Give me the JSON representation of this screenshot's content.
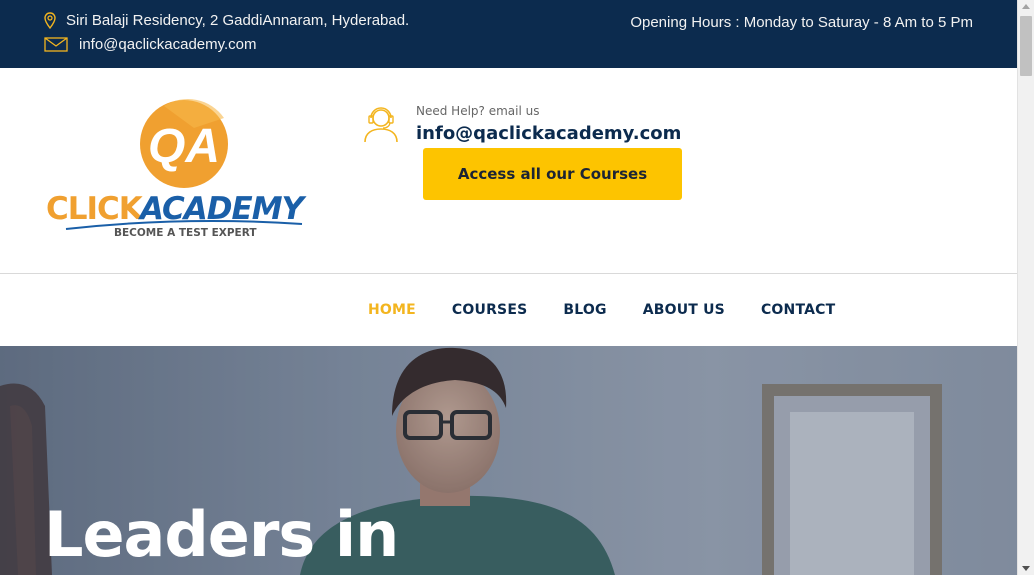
{
  "topbar": {
    "address": "Siri Balaji Residency, 2 GaddiAnnaram, Hyderabad.",
    "email": "info@qaclickacademy.com",
    "hours": "Opening Hours : Monday to Saturay - 8 Am to 5 Pm",
    "icons": [
      "location-pin-icon",
      "envelope-icon"
    ]
  },
  "header": {
    "logo": {
      "monogram": "QA",
      "brand_left": "CLICK",
      "brand_right": "ACADEMY",
      "tagline": "BECOME A TEST EXPERT"
    },
    "help_small": "Need Help? email us",
    "help_email": "info@qaclickacademy.com",
    "help_icon": "support-agent-icon",
    "cta_label": "Access all our Courses"
  },
  "nav": {
    "items": [
      {
        "label": "HOME",
        "active": true
      },
      {
        "label": "COURSES",
        "active": false
      },
      {
        "label": "BLOG",
        "active": false
      },
      {
        "label": "ABOUT US",
        "active": false
      },
      {
        "label": "CONTACT",
        "active": false
      }
    ]
  },
  "hero": {
    "title": "Leaders in"
  },
  "colors": {
    "navy": "#0c2b4e",
    "accent_yellow": "#fdc400",
    "active_nav": "#f3b51f",
    "logo_orange": "#f0a030",
    "logo_blue": "#1a5fa8"
  }
}
